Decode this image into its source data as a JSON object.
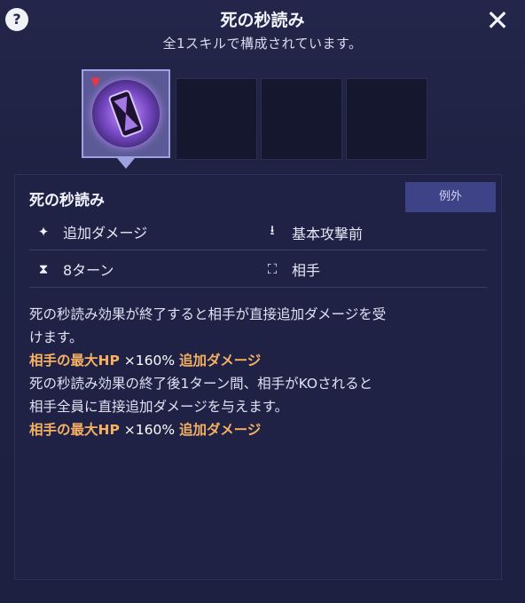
{
  "header": {
    "help_label": "?",
    "title": "死の秒読み",
    "subtitle": "全1スキルで構成されています。",
    "close_label": "✕"
  },
  "skill_slots": [
    {
      "icon": "hourglass-skill-icon",
      "selected": true,
      "debuff_arrow": "▼"
    },
    {
      "icon": "empty-slot",
      "selected": false
    },
    {
      "icon": "empty-slot",
      "selected": false
    },
    {
      "icon": "empty-slot",
      "selected": false
    }
  ],
  "skill": {
    "name": "死の秒読み",
    "tag": "例外",
    "attributes": {
      "type": {
        "icon": "sparkle-icon",
        "label": "追加ダメージ"
      },
      "timing": {
        "icon": "download-icon",
        "label": "基本攻撃前"
      },
      "duration": {
        "icon": "hourglass-icon",
        "label": "8ターン"
      },
      "target": {
        "icon": "target-person-icon",
        "label": "相手"
      }
    },
    "description": {
      "line1": "死の秒読み効果が終了すると相手が直接追加ダメージを受",
      "line2": "けます。",
      "effect1": {
        "stat": "相手の最大HP",
        "mult": "×160%",
        "effect": "追加ダメージ"
      },
      "line3": "死の秒読み効果の終了後1ターン間、相手がKOされると",
      "line4": "相手全員に直接追加ダメージを与えます。",
      "effect2": {
        "stat": "相手の最大HP",
        "mult": "×160%",
        "effect": "追加ダメージ"
      }
    }
  },
  "colors": {
    "highlight": "#f5b064",
    "tag_bg": "#3e4286",
    "panel_bg": "#1f2244"
  }
}
